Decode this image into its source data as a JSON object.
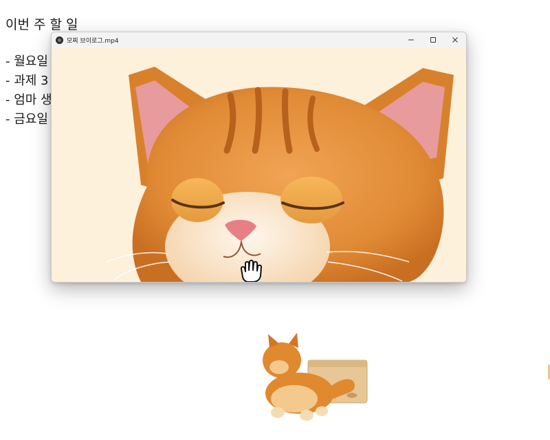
{
  "note": {
    "title": "이번 주 할 일",
    "items": [
      "월요일",
      "과제 3",
      "엄마 생",
      "금요일"
    ]
  },
  "window": {
    "title": "모찌 브이로그.mp4",
    "controls": {
      "minimize_icon": "minimize-icon",
      "maximize_icon": "maximize-icon",
      "close_icon": "close-icon"
    }
  },
  "video": {
    "subject": "cat-closeup-frame"
  },
  "cursor": {
    "icon": "hand-pointer-icon"
  },
  "pet": {
    "icon": "kitten-pet-icon",
    "box_icon": "cardboard-box-icon"
  },
  "colors": {
    "fur": "#e0892f",
    "fur_light": "#f4c98d",
    "background_video": "#fdf1dc",
    "nose": "#e77f84"
  }
}
